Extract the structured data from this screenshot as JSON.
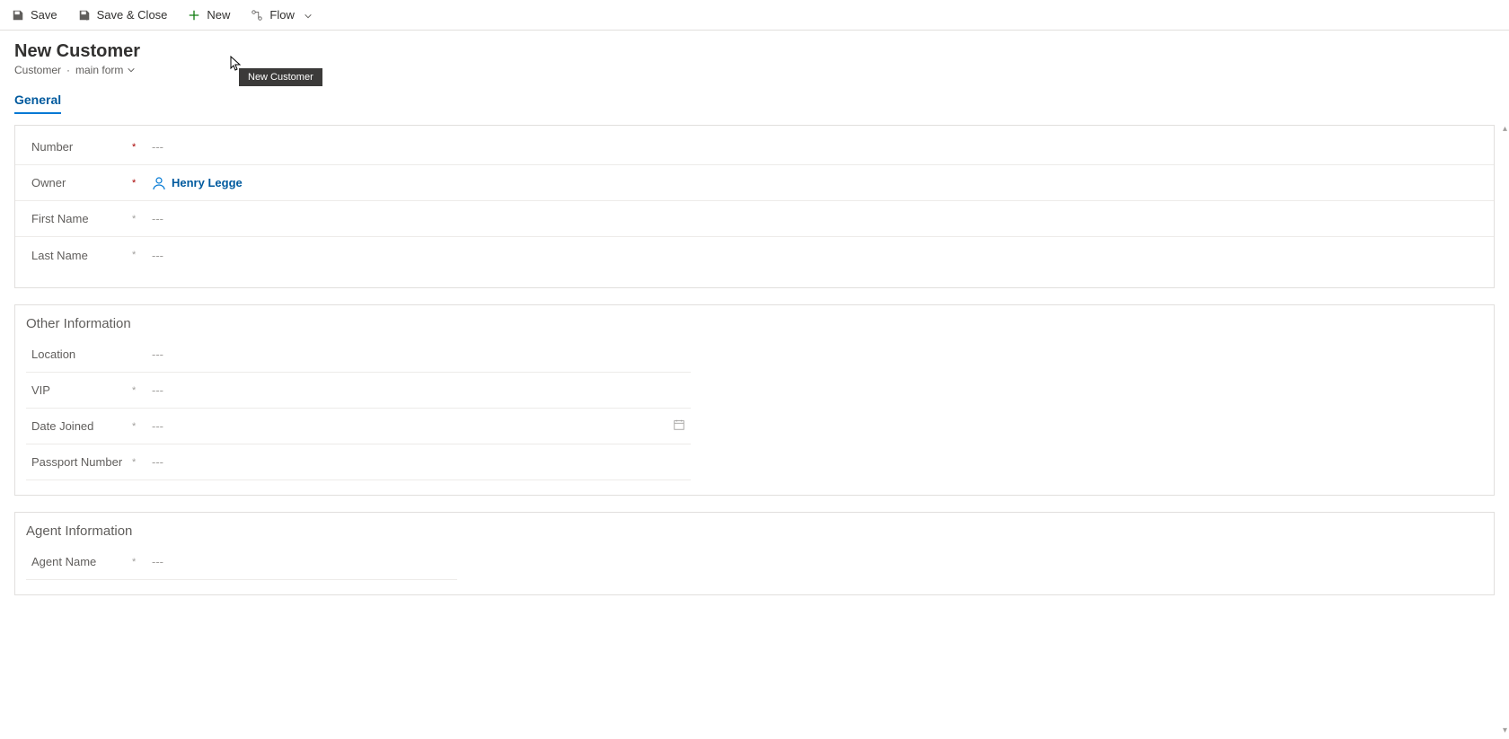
{
  "toolbar": {
    "save": "Save",
    "save_close": "Save & Close",
    "new": "New",
    "flow": "Flow"
  },
  "header": {
    "title": "New Customer",
    "entity": "Customer",
    "form_selector": "main form",
    "tooltip": "New Customer"
  },
  "tabs": {
    "general": "General"
  },
  "sections": {
    "main": {
      "fields": {
        "number": {
          "label": "Number",
          "required": "*",
          "value": "---"
        },
        "owner": {
          "label": "Owner",
          "required": "*",
          "value": "Henry Legge"
        },
        "first_name": {
          "label": "First Name",
          "required": "*",
          "value": "---"
        },
        "last_name": {
          "label": "Last Name",
          "required": "*",
          "value": "---"
        }
      }
    },
    "other": {
      "title": "Other Information",
      "fields": {
        "location": {
          "label": "Location",
          "required": "",
          "value": "---"
        },
        "vip": {
          "label": "VIP",
          "required": "*",
          "value": "---"
        },
        "date_joined": {
          "label": "Date Joined",
          "required": "*",
          "value": "---"
        },
        "passport": {
          "label": "Passport Number",
          "required": "*",
          "value": "---"
        }
      }
    },
    "agent": {
      "title": "Agent Information",
      "fields": {
        "agent_name": {
          "label": "Agent Name",
          "required": "*",
          "value": "---"
        }
      }
    }
  },
  "icons": {
    "save": "save-icon",
    "save_close": "save-close-icon",
    "new": "plus-icon",
    "flow": "flow-icon",
    "chevron_down": "chevron-down-icon",
    "person": "person-icon",
    "calendar": "calendar-icon"
  }
}
